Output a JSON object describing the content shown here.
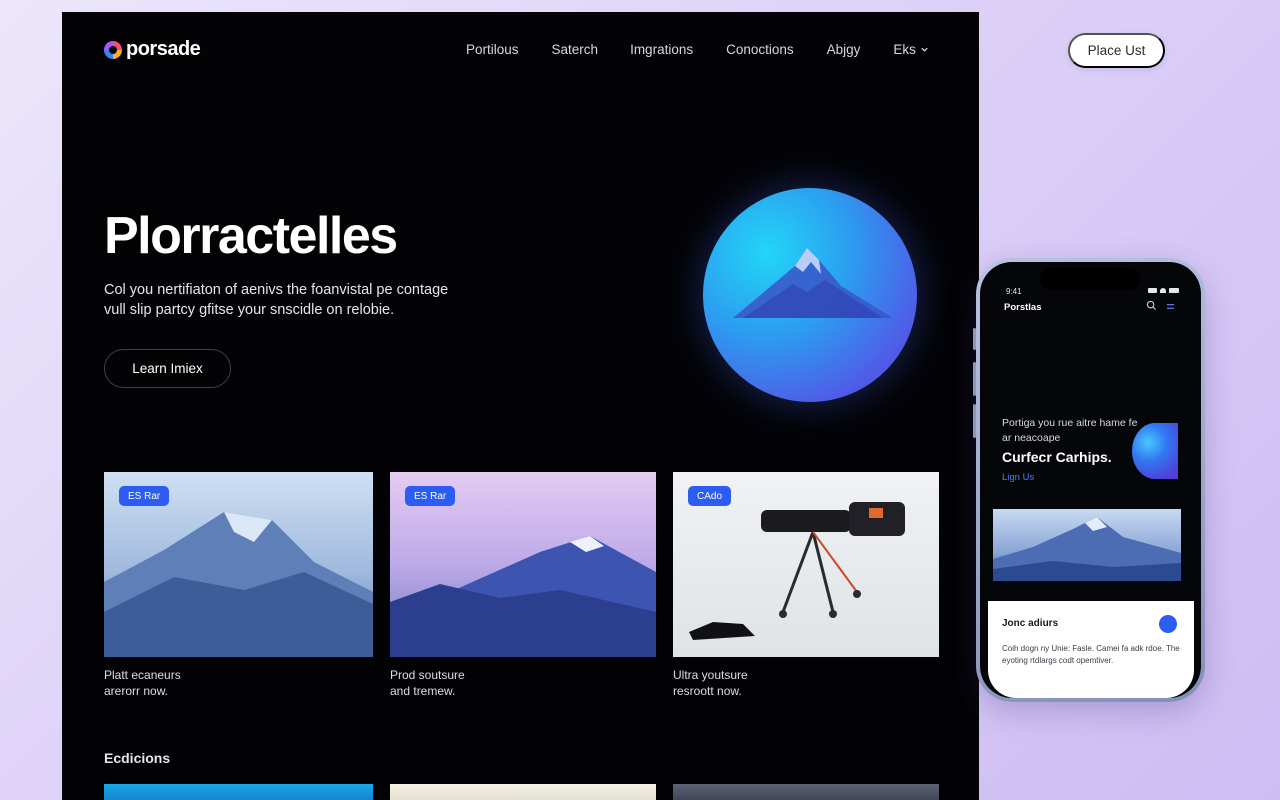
{
  "brand": {
    "name": "porsade"
  },
  "nav": {
    "items": [
      "Portilous",
      "Saterch",
      "Imgrations",
      "Conoctions",
      "Abjgy"
    ],
    "dropdown_label": "Eks"
  },
  "hero": {
    "title": "Plorractelles",
    "subtitle": "Col you nertifiaton of aenivs the foanvistal pe contage vull slip partcy gfitse your snscidle on relobie.",
    "button_label": "Learn Imiex"
  },
  "cards": [
    {
      "badge": "ES Rar",
      "caption_line1": "Platt ecaneurs",
      "caption_line2": "arerorr now."
    },
    {
      "badge": "ES Rar",
      "caption_line1": "Prod soutsure",
      "caption_line2": "and tremew."
    },
    {
      "badge": "CAdo",
      "caption_line1": "Ultra youtsure",
      "caption_line2": "resroott now."
    }
  ],
  "section": {
    "title": "Ecdicions"
  },
  "cta": {
    "label": "Place Ust"
  },
  "phone": {
    "time": "9:41",
    "title": "Porstlas",
    "intro": "Portiga you rue aitre hame fe ar neacoape",
    "headline": "Curfecr Carhips.",
    "link": "Lign Us",
    "card_title": "Jonc adiurs",
    "card_desc": "Coih dogn ny Unie: Fasle. Camei fa adk rdoe. The eyoting rtdlargs codt opemtiver."
  },
  "colors": {
    "accent_blue": "#2c5cf2",
    "link_blue": "#4f7dff",
    "page_bg": "#030306",
    "backdrop": "#ddd1f7"
  }
}
